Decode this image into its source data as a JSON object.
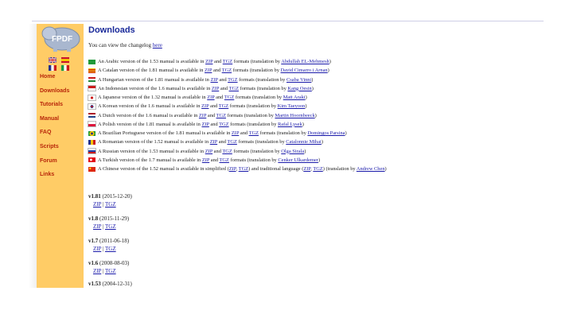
{
  "sidebar": {
    "logo_text": "FPDF",
    "nav": [
      "Home",
      "Downloads",
      "Tutorials",
      "Manual",
      "FAQ",
      "Scripts",
      "Forum",
      "Links"
    ]
  },
  "main": {
    "title": "Downloads",
    "intro_text": "You can view the changelog ",
    "intro_link": "here",
    "translations": [
      {
        "flag": "arabic",
        "pre": "An Arabic version of the 1.53 manual is available in ",
        "a": "ZIP",
        "mid": " and ",
        "b": "TGZ",
        "post": " formats (translation by ",
        "tr": "Abdullah EL-Mehmesh",
        "end": ")"
      },
      {
        "flag": "catalan",
        "pre": "A Catalan version of the 1.81 manual is available in ",
        "a": "ZIP",
        "mid": " and ",
        "b": "TGZ",
        "post": " formats (translation by ",
        "tr": "David Cimarro i Arnan",
        "end": ")"
      },
      {
        "flag": "hungarian",
        "pre": "A Hungarian version of the 1.81 manual is available in ",
        "a": "ZIP",
        "mid": " and ",
        "b": "TGZ",
        "post": " formats (translation by ",
        "tr": "Csaba Vinni",
        "end": ")"
      },
      {
        "flag": "indonesian",
        "pre": "An Indonesian version of the 1.6 manual is available in ",
        "a": "ZIP",
        "mid": " and ",
        "b": "TGZ",
        "post": " formats (translation by ",
        "tr": "Kang Oesin",
        "end": ")"
      },
      {
        "flag": "japanese",
        "pre": "A Japanese version of the 1.32 manual is available in ",
        "a": "ZIP",
        "mid": " and ",
        "b": "TGZ",
        "post": " formats (translation by ",
        "tr": "Matt Araki",
        "end": ")"
      },
      {
        "flag": "korean",
        "pre": "A Korean version of the 1.6 manual is available in ",
        "a": "ZIP",
        "mid": " and ",
        "b": "TGZ",
        "post": " formats (translation by ",
        "tr": "Kim Taeyoon",
        "end": ")"
      },
      {
        "flag": "dutch",
        "pre": "A Dutch version of the 1.6 manual is available in ",
        "a": "ZIP",
        "mid": " and ",
        "b": "TGZ",
        "post": " formats (translation by ",
        "tr": "Martin Hoornbeeck",
        "end": ")"
      },
      {
        "flag": "polish",
        "pre": "A Polish version of the 1.81 manual is available in ",
        "a": "ZIP",
        "mid": " and ",
        "b": "TGZ",
        "post": " formats (translation by ",
        "tr": "Rafal Lysek",
        "end": ")"
      },
      {
        "flag": "brazil",
        "pre": "A Brazilian Portuguese version of the 1.81 manual is available in ",
        "a": "ZIP",
        "mid": " and ",
        "b": "TGZ",
        "post": " formats (translation by ",
        "tr": "Domingos Parsina",
        "end": ")"
      },
      {
        "flag": "romanian",
        "pre": "A Romanian version of the 1.52 manual is available in ",
        "a": "ZIP",
        "mid": " and ",
        "b": "TGZ",
        "post": " formats (translation by ",
        "tr": "Catalonnie Mihai",
        "end": ")"
      },
      {
        "flag": "russian",
        "pre": "A Russian version of the 1.53 manual is available in ",
        "a": "ZIP",
        "mid": " and ",
        "b": "TGZ",
        "post": " formats (translation by ",
        "tr": "Olga Sirala",
        "end": ")"
      },
      {
        "flag": "turkish",
        "pre": "A Turkish version of the 1.7 manual is available in ",
        "a": "ZIP",
        "mid": " and ",
        "b": "TGZ",
        "post": " formats (translation by ",
        "tr": "Cenker Ulkardemer",
        "end": ")"
      },
      {
        "flag": "chinese",
        "pre": "A Chinese version of the 1.52 manual is available in simplified (",
        "a": "ZIP",
        "mid": ", ",
        "b": "TGZ",
        "post": ") and traditional language (",
        "c": "ZIP",
        "d": "TGZ",
        "post2": ") (translation by ",
        "tr": "Andrew Chen",
        "end": ")"
      }
    ],
    "versions": [
      {
        "num": "v1.81",
        "date": " (2015-12-20)",
        "zip": "ZIP",
        "tgz": "TGZ"
      },
      {
        "num": "v1.8",
        "date": " (2015-11-29)",
        "zip": "ZIP",
        "tgz": "TGZ"
      },
      {
        "num": "v1.7",
        "date": " (2011-06-18)",
        "zip": "ZIP",
        "tgz": "TGZ"
      },
      {
        "num": "v1.6",
        "date": " (2008-08-03)",
        "zip": "ZIP",
        "tgz": "TGZ"
      },
      {
        "num": "v1.53",
        "date": " (2004-12-31)",
        "zip": "",
        "tgz": ""
      }
    ],
    "separator": " | "
  },
  "colors": {
    "sidebar_bg": "#ffcc66",
    "nav_text": "#b8270a",
    "title": "#1a2a9a",
    "link": "#1a1aaa"
  }
}
